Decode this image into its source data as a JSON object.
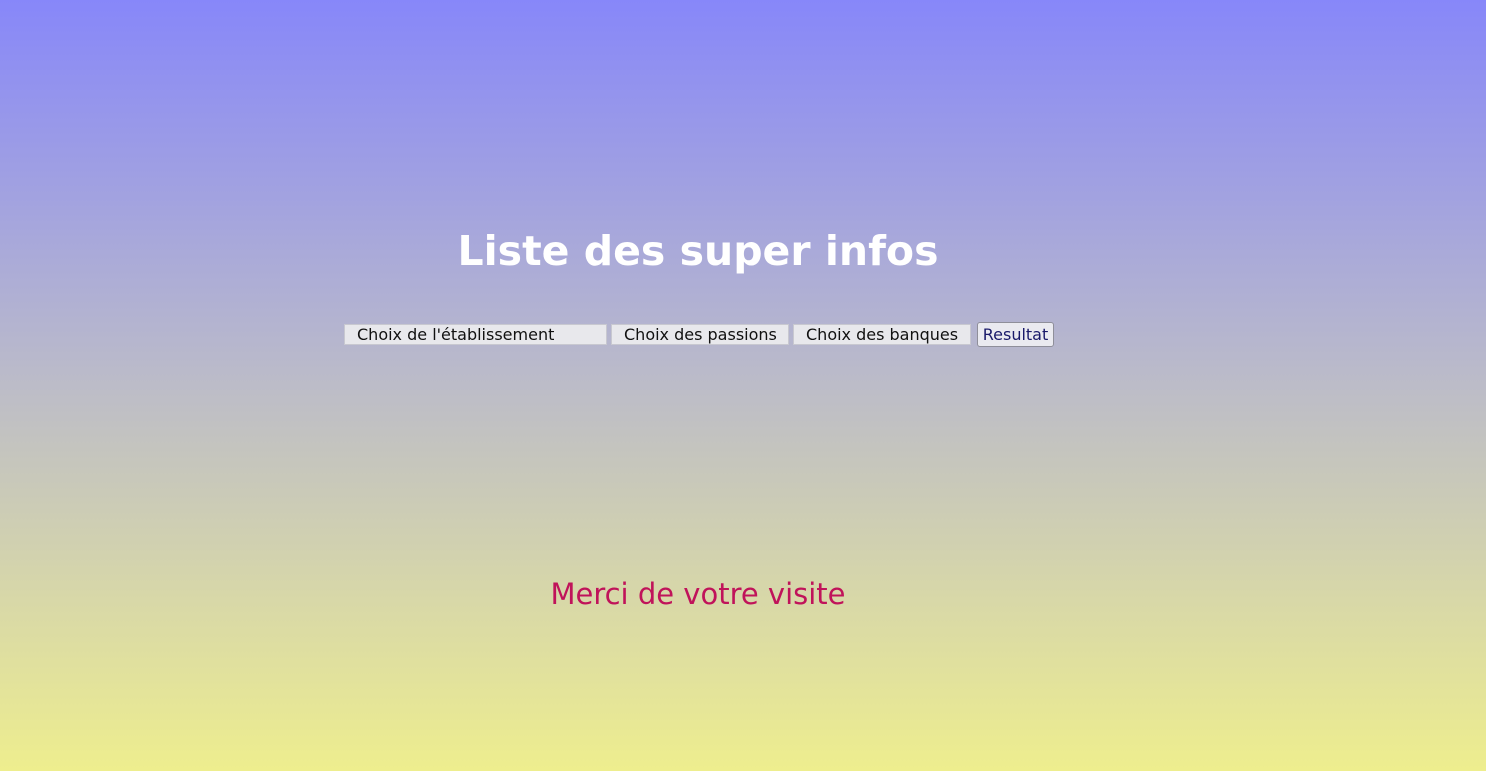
{
  "page": {
    "title": "Liste des super infos",
    "footer_text": "Merci de votre visite"
  },
  "filters": {
    "etablissement": {
      "selected": "Choix de l'établissement"
    },
    "passions": {
      "selected": "Choix des passions"
    },
    "banques": {
      "selected": "Choix des banques"
    }
  },
  "actions": {
    "result_label": "Resultat"
  },
  "colors": {
    "gradient_top": "#8787f9",
    "gradient_bottom": "#eeee8e",
    "title": "#ffffff",
    "footer_text": "#c0135a"
  }
}
